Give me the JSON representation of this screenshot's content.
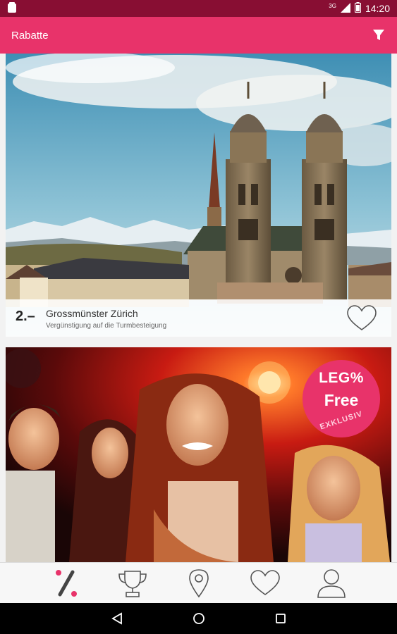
{
  "status_bar": {
    "time": "14:20",
    "network": "3G"
  },
  "app_bar": {
    "title": "Rabatte",
    "filter_icon": "filter-icon"
  },
  "offers": [
    {
      "rank": "2.–",
      "title": "Grossmünster Zürich",
      "subtitle": "Vergünstigung auf die Turmbesteigung",
      "favorite_icon": "heart-outline-icon"
    },
    {
      "badge": {
        "brand": "LEG%",
        "text": "Free",
        "label": "EXKLUSIV"
      }
    }
  ],
  "bottom_nav": {
    "items": [
      {
        "icon": "percent-icon",
        "active": true
      },
      {
        "icon": "trophy-icon",
        "active": false
      },
      {
        "icon": "location-pin-icon",
        "active": false
      },
      {
        "icon": "heart-icon",
        "active": false
      },
      {
        "icon": "user-icon",
        "active": false
      }
    ]
  },
  "colors": {
    "primary": "#e8336a",
    "status_bar": "#880e33",
    "nav_active": "#e8336a",
    "nav_inactive": "#555555"
  }
}
